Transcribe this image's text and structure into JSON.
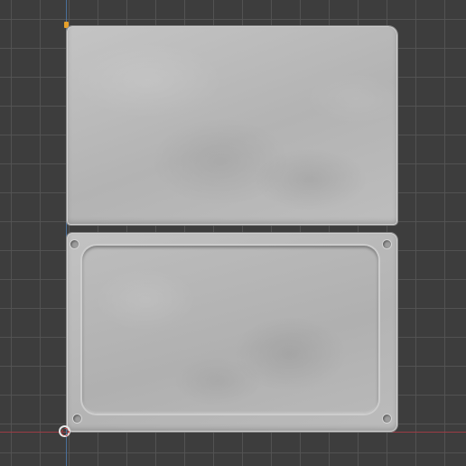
{
  "viewport": {
    "background_color": "#3d3d3d",
    "grid_color": "#545454",
    "axis_x_color": "#9a3c45",
    "axis_y_color": "#4a6f9a"
  },
  "objects": [
    {
      "name": "top-plate",
      "material_color": "#b7b7b7"
    },
    {
      "name": "bottom-plate",
      "material_color": "#b7b7b7",
      "inset": true,
      "screw_holes": 4
    }
  ],
  "cursor": {
    "icon": "3d-cursor-icon",
    "color": "#d23c3c"
  }
}
